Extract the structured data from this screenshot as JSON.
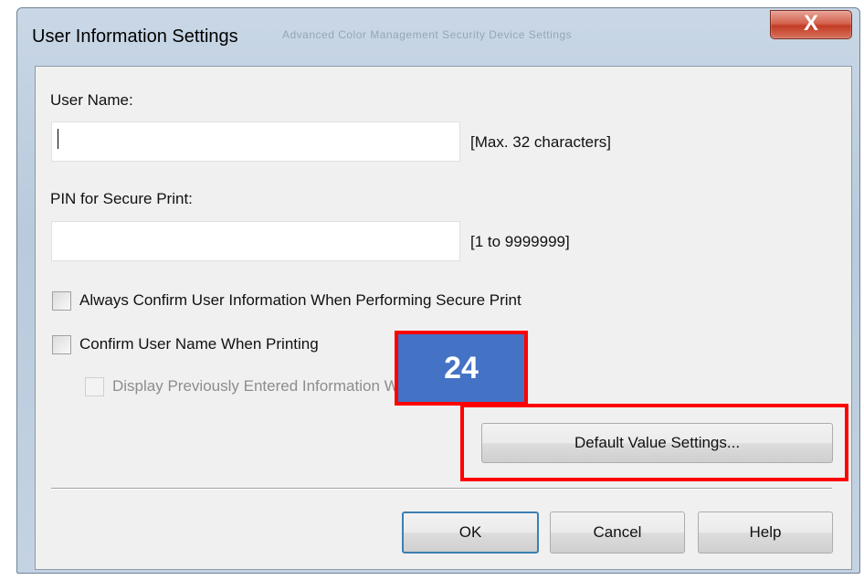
{
  "window": {
    "title": "User Information Settings",
    "background_tabs": "Advanced   Color Management   Security   Device Settings",
    "close_glyph": "X"
  },
  "user_name": {
    "label": "User Name:",
    "value": "",
    "hint": "[Max. 32 characters]"
  },
  "pin": {
    "label": "PIN for Secure Print:",
    "value": "",
    "hint": "[1 to 9999999]"
  },
  "options": {
    "always_confirm": {
      "label": "Always Confirm User Information When Performing Secure Print",
      "checked": false
    },
    "confirm_name": {
      "label": "Confirm User Name When Printing",
      "checked": false
    },
    "display_previous": {
      "label": "Display Previously Entered Information When Confirming",
      "checked": false,
      "enabled": false
    }
  },
  "buttons": {
    "default_value_settings": "Default Value Settings...",
    "ok": "OK",
    "cancel": "Cancel",
    "help": "Help"
  },
  "annotation": {
    "step_number": "24",
    "badge_color": "#4472c4",
    "highlight_color": "#ff0000"
  }
}
